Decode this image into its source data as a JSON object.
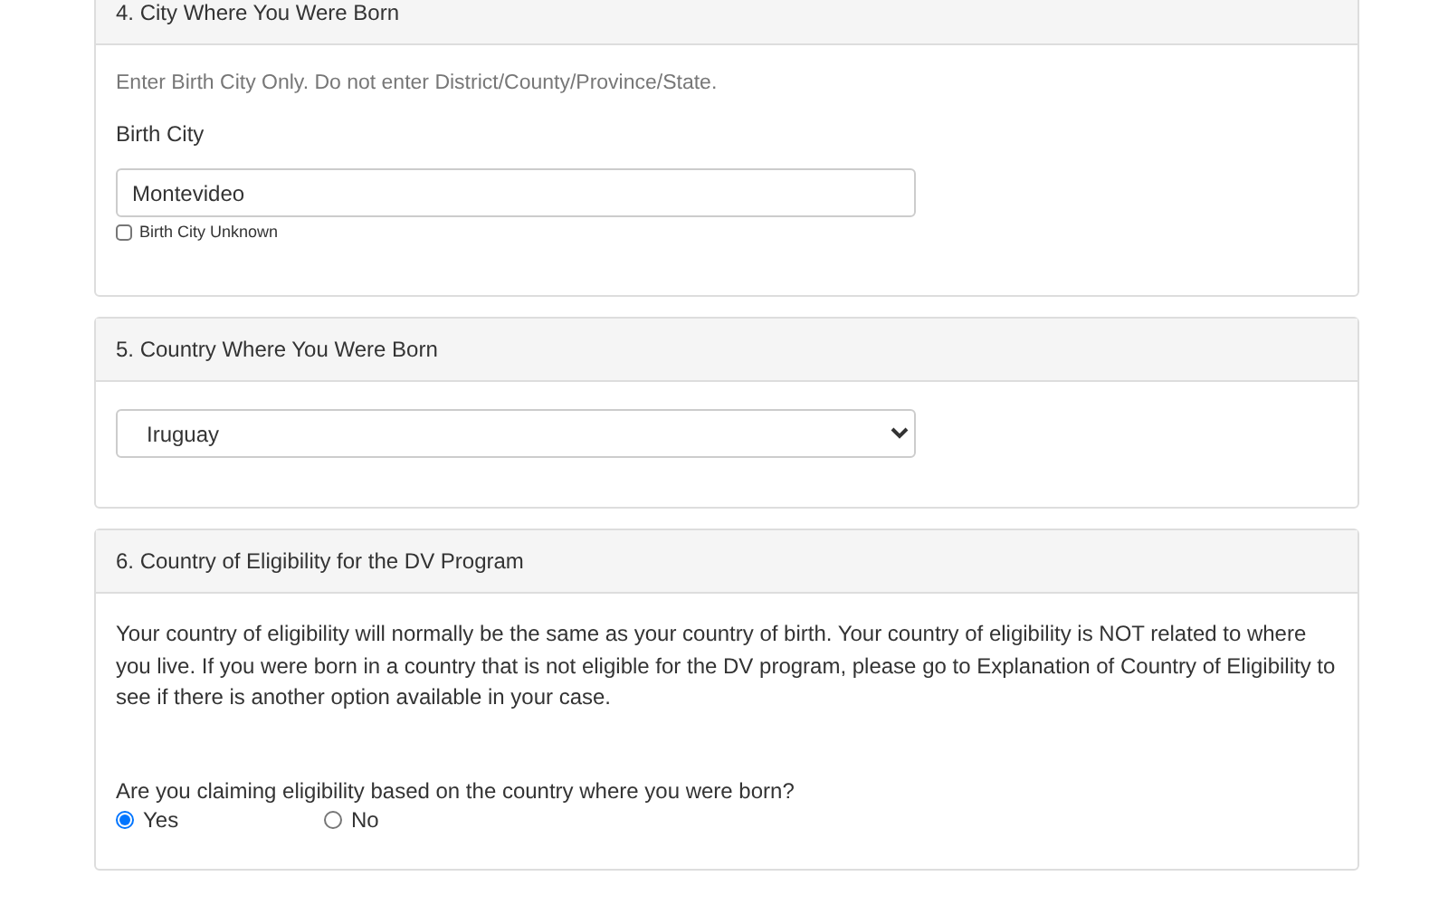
{
  "sections": [
    {
      "title": "4. City Where You Were Born",
      "kind": "city",
      "hint": "Enter Birth City Only. Do not enter District/County/Province/State.",
      "field_label": "Birth City",
      "value": "Montevideo",
      "checkbox": {
        "label": "Birth City Unknown",
        "checked": false
      }
    },
    {
      "title": "5. Country Where You Were Born",
      "kind": "country",
      "value": "Iruguay"
    },
    {
      "title": "6. Country of Eligibility for the DV Program",
      "kind": "eligibility",
      "paragraph": "Your country of eligibility will normally be the same as your country of birth. Your country of eligibility is NOT related to where you live. If you were born in a country that is not eligible for the DV program, please go to Explanation of Country of Eligibility to see if there is another option available in your case.",
      "question": "Are you claiming eligibility based on the country where you were born?",
      "options": [
        {
          "label": "Yes",
          "selected": true
        },
        {
          "label": "No",
          "selected": false
        }
      ]
    }
  ]
}
